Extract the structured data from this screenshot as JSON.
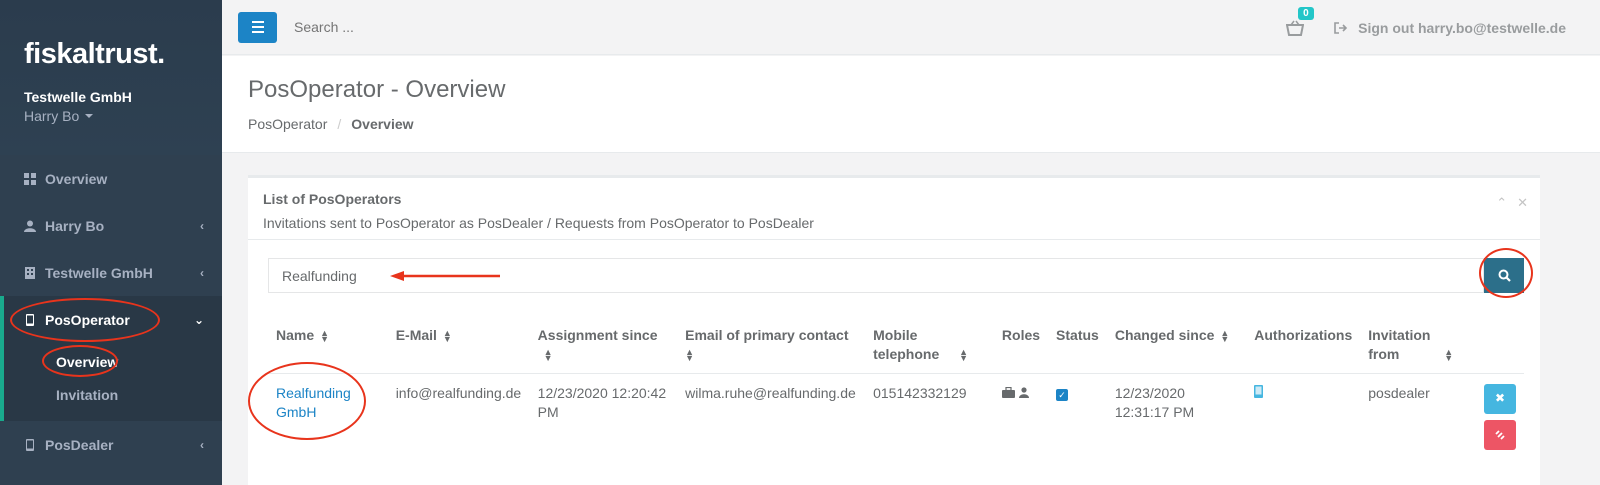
{
  "sidebar": {
    "logo": "fiskaltrust.",
    "company": "Testwelle GmbH",
    "user": "Harry Bo",
    "items": [
      {
        "label": "Overview",
        "icon": "grid-icon"
      },
      {
        "label": "Harry Bo",
        "icon": "user-icon"
      },
      {
        "label": "Testwelle GmbH",
        "icon": "building-icon"
      },
      {
        "label": "PosOperator",
        "icon": "tablet-icon"
      },
      {
        "label": "PosDealer",
        "icon": "tablet-icon"
      }
    ],
    "subitems": [
      {
        "label": "Overview"
      },
      {
        "label": "Invitation"
      }
    ]
  },
  "topbar": {
    "search_placeholder": "Search ...",
    "basket_count": "0",
    "signout_label": "Sign out harry.bo@testwelle.de"
  },
  "heading": {
    "title": "PosOperator - Overview",
    "breadcrumb": [
      "PosOperator",
      "/",
      "Overview"
    ]
  },
  "panel": {
    "title": "List of PosOperators",
    "subtitle": "Invitations sent to PosOperator as PosDealer / Requests from PosOperator to PosDealer",
    "search_value": "Realfunding",
    "columns": [
      "Name",
      "E-Mail",
      "Assignment since",
      "Email of primary contact",
      "Mobile telephone",
      "Roles",
      "Status",
      "Changed since",
      "Authorizations",
      "Invitation from"
    ],
    "rows": [
      {
        "name": "Realfunding GmbH",
        "email": "info@realfunding.de",
        "assignment_since": "12/23/2020 12:20:42 PM",
        "primary_contact": "wilma.ruhe@realfunding.de",
        "mobile": "015142332129",
        "changed_since": "12/23/2020 12:31:17 PM",
        "invitation_from": "posdealer"
      }
    ]
  },
  "colors": {
    "sidebar_bg": "#2f4050",
    "accent_green": "#19aa8d",
    "primary_blue": "#1c84c6",
    "annotation_red": "#e8341c",
    "danger": "#ed5565"
  }
}
